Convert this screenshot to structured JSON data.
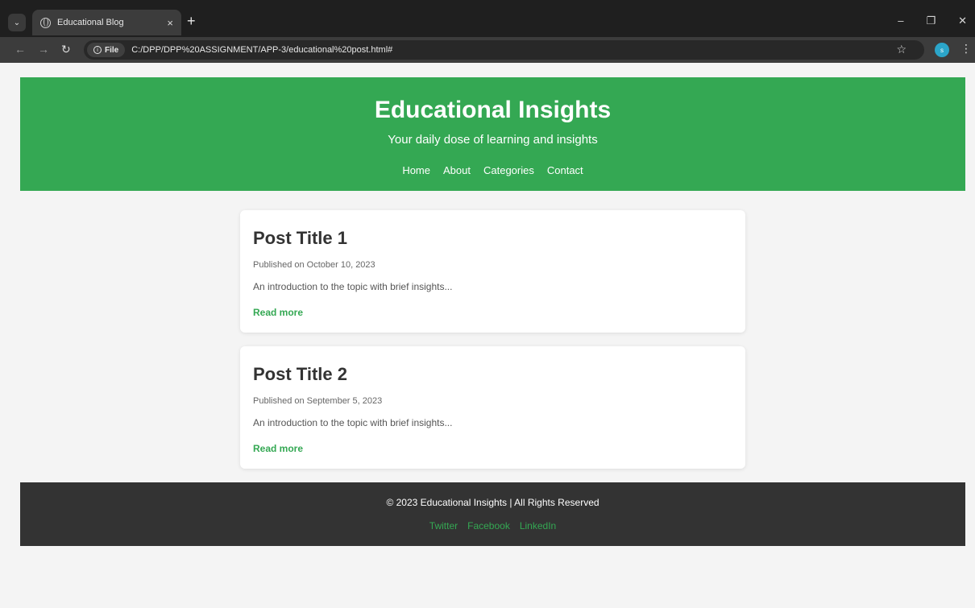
{
  "browser": {
    "tab_title": "Educational Blog",
    "tab_close": "×",
    "new_tab": "+",
    "site_chip": "File",
    "url": "C:/DPP/DPP%20ASSIGNMENT/APP-3/educational%20post.html#",
    "avatar_letter": "s",
    "controls": {
      "minimize": "–",
      "restore": "❐",
      "close": "✕"
    },
    "icons": [
      "tab-search-icon",
      "globe-icon",
      "back-icon",
      "forward-icon",
      "reload-icon",
      "info-icon",
      "star-icon",
      "menu-kebab-icon"
    ]
  },
  "header": {
    "title": "Educational Insights",
    "tagline": "Your daily dose of learning and insights",
    "nav": [
      "Home",
      "About",
      "Categories",
      "Contact"
    ]
  },
  "posts": [
    {
      "title": "Post Title 1",
      "date": "Published on October 10, 2023",
      "excerpt": "An introduction to the topic with brief insights...",
      "link": "Read more"
    },
    {
      "title": "Post Title 2",
      "date": "Published on September 5, 2023",
      "excerpt": "An introduction to the topic with brief insights...",
      "link": "Read more"
    }
  ],
  "footer": {
    "copyright": "© 2023 Educational Insights | All Rights Reserved",
    "social": [
      "Twitter",
      "Facebook",
      "LinkedIn"
    ]
  },
  "colors": {
    "accent": "#34a853",
    "footer_bg": "#333333",
    "page_bg": "#f4f4f4"
  }
}
